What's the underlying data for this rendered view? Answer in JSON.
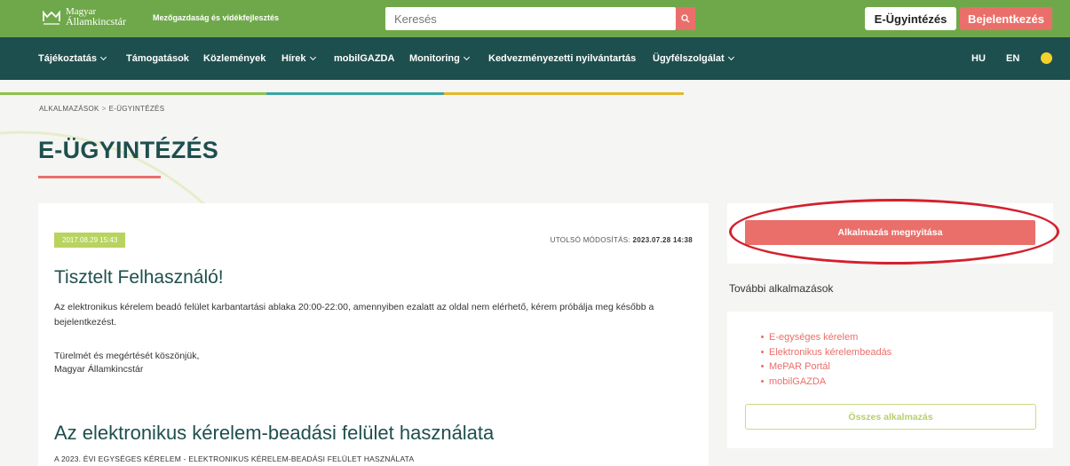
{
  "header": {
    "logo_line1": "Magyar",
    "logo_line2": "Államkincstár",
    "tagline": "Mezőgazdaság és vidékfejlesztés",
    "search_placeholder": "Keresés",
    "eugy_button": "E-Ügyintézés",
    "login_button": "Bejelentkezés"
  },
  "nav": {
    "items": [
      {
        "label": "Tájékoztatás",
        "dropdown": true
      },
      {
        "label": "Támogatások",
        "dropdown": false
      },
      {
        "label": "Közlemények",
        "dropdown": false
      },
      {
        "label": "Hírek",
        "dropdown": true
      },
      {
        "label": "mobilGAZDA",
        "dropdown": false
      },
      {
        "label": "Monitoring",
        "dropdown": true
      },
      {
        "label": "Kedvezményezetti nyilvántartás",
        "dropdown": false
      },
      {
        "label": "Ügyfélszolgálat",
        "dropdown": true
      }
    ],
    "lang_hu": "HU",
    "lang_en": "EN",
    "accessibility_icon": "accessibility-icon"
  },
  "breadcrumb": {
    "item1": "ALKALMAZÁSOK",
    "separator": ">",
    "item2": "E-ÜGYINTÉZÉS"
  },
  "page_title": "E-ÜGYINTÉZÉS",
  "article": {
    "date": "2017.08.29 15:43",
    "modified_label": "UTOLSÓ MÓDOSÍTÁS:",
    "modified_value": "2023.07.28 14:38",
    "greeting": "Tisztelt Felhasználó!",
    "paragraph": "Az elektronikus kérelem beadó felület karbantartási ablaka 20:00-22:00, amennyiben ezalatt az oldal nem elérhető, kérem próbálja meg később a bejelentkezést.",
    "thanks": "Türelmét és megértését köszönjük,",
    "signature": "Magyar Államkincstár",
    "section_title": "Az elektronikus kérelem-beadási felület használata",
    "section_sub": "A 2023. ÉVI EGYSÉGES KÉRELEM - ELEKTRONIKUS KÉRELEM-BEADÁSI FELÜLET HASZNÁLATA"
  },
  "sidebar": {
    "open_button": "Alkalmazás megnyitása",
    "more_title": "További alkalmazások",
    "apps": [
      "E-egységes kérelem",
      "Elektronikus kérelembeadás",
      "MePAR Portál",
      "mobilGAZDA"
    ],
    "all_button": "Összes alkalmazás"
  },
  "colors": {
    "top_green": "#6fa84a",
    "nav_dark": "#1d4f4e",
    "accent_red": "#ea6f6a",
    "badge_green": "#b8d35f",
    "highlight_ellipse": "#d4202d"
  }
}
